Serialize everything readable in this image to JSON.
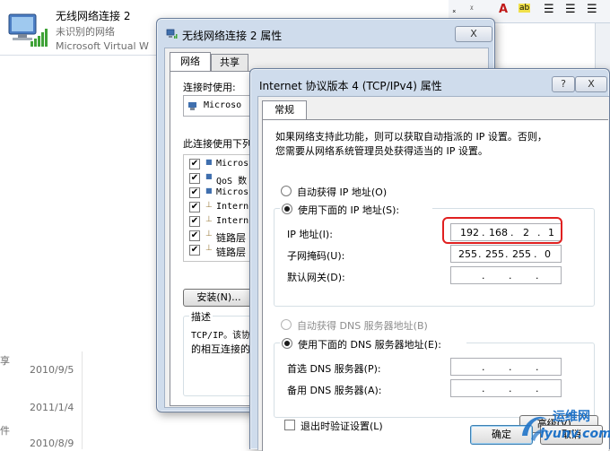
{
  "network_list": {
    "name": "无线网络连接 2",
    "status": "未识别的网络",
    "adapter": "Microsoft Virtual W"
  },
  "file_list": {
    "partial_1": "享",
    "partial_2": "件",
    "dates": [
      "2010/9/5",
      "2011/1/4",
      "2010/8/9"
    ]
  },
  "props_window": {
    "title": "无线网络连接 2 属性",
    "close_label": "X",
    "tabs": [
      "网络",
      "共享"
    ],
    "connect_using_label": "连接时使用:",
    "adapter_text": "Microso",
    "items_label": "此连接使用下列",
    "items": [
      "Micros",
      "QoS 数",
      "Micros",
      "Intern",
      "Intern",
      "链路层",
      "链路层"
    ],
    "install_button": "安装(N)...",
    "desc_title": "描述",
    "desc_line1": "TCP/IP。该协",
    "desc_line2": "的相互连接的"
  },
  "ipv4_dialog": {
    "title": "Internet 协议版本 4 (TCP/IPv4) 属性",
    "help_label": "?",
    "close_label": "X",
    "tab": "常规",
    "intro_line1": "如果网络支持此功能，则可以获取自动指派的 IP 设置。否则，",
    "intro_line2": "您需要从网络系统管理员处获得适当的 IP 设置。",
    "auto_ip_label": "自动获得 IP 地址(O)",
    "manual_ip_label": "使用下面的 IP 地址(S):",
    "ip_label": "IP 地址(I):",
    "ip_value": [
      "192",
      "168",
      "2",
      "1"
    ],
    "mask_label": "子网掩码(U):",
    "mask_value": [
      "255",
      "255",
      "255",
      "0"
    ],
    "gateway_label": "默认网关(D):",
    "auto_dns_label": "自动获得 DNS 服务器地址(B)",
    "manual_dns_label": "使用下面的 DNS 服务器地址(E):",
    "dns1_label": "首选 DNS 服务器(P):",
    "dns2_label": "备用 DNS 服务器(A):",
    "validate_label": "退出时验证设置(L)",
    "advanced_button": "高级(V)...",
    "ok_button": "确定",
    "cancel_button": "取消",
    "dot": "."
  },
  "watermark": {
    "line1": "运维网",
    "line2": "iyunv.com"
  },
  "colors": {
    "highlight_red": "#e02020",
    "title_bg": "#cfdcec",
    "watermark_blue": "#1f73c8"
  }
}
